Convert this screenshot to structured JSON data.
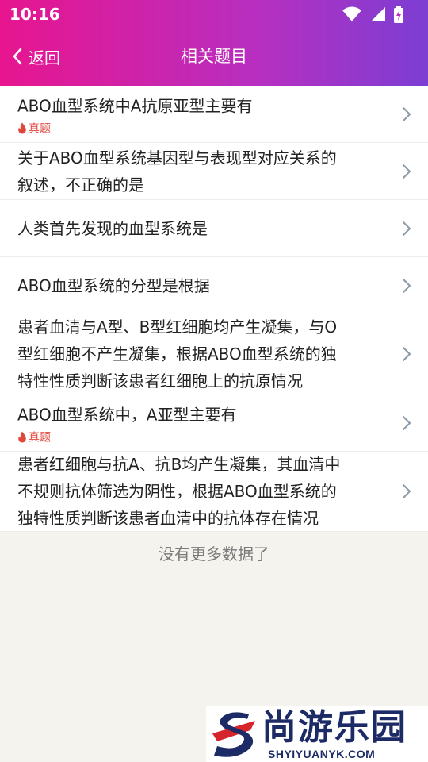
{
  "status_bar": {
    "time": "10:16"
  },
  "nav": {
    "back_label": "返回",
    "title": "相关题目"
  },
  "questions": [
    {
      "lines": [
        "ABO血型系统中A抗原亚型主要有"
      ],
      "tag": "真题"
    },
    {
      "lines": [
        "关于ABO血型系统基因型与表现型对应关系的",
        "叙述，不正确的是"
      ],
      "tag": ""
    },
    {
      "lines": [
        "人类首先发现的血型系统是"
      ],
      "tag": ""
    },
    {
      "lines": [
        "ABO血型系统的分型是根据"
      ],
      "tag": ""
    },
    {
      "lines": [
        "患者血清与A型、B型红细胞均产生凝集，与O",
        "型红细胞不产生凝集，根据ABO血型系统的独",
        "特性性质判断该患者红细胞上的抗原情况"
      ],
      "tag": ""
    },
    {
      "lines": [
        "ABO血型系统中，A亚型主要有"
      ],
      "tag": "真题"
    },
    {
      "lines": [
        "患者红细胞与抗A、抗B均产生凝集，其血清中",
        "不规则抗体筛选为阴性，根据ABO血型系统的",
        "独特性质判断该患者血清中的抗体存在情况"
      ],
      "tag": ""
    }
  ],
  "footer": {
    "no_more": "没有更多数据了"
  },
  "watermark": {
    "brand": "尚游乐园",
    "domain": "SHYIYUANYK.COM"
  },
  "colors": {
    "header_start": "#e8158f",
    "header_end": "#7c3ed3",
    "tag": "#e0473c",
    "page_bg": "#f5f3ee"
  }
}
